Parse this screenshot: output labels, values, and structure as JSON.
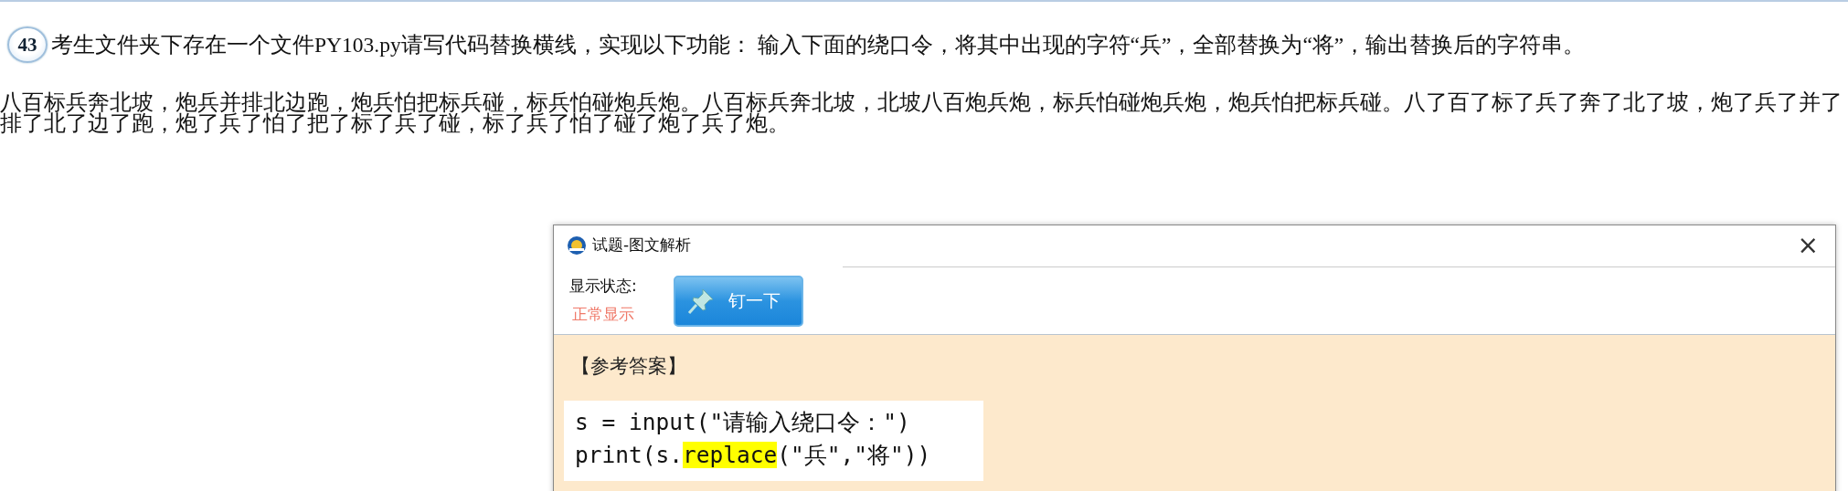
{
  "question": {
    "number": "43",
    "text": "考生文件夹下存在一个文件PY103.py请写代码替换横线，实现以下功能： 输入下面的绕口令，将其中出现的字符“兵”，全部替换为“将”，输出替换后的字符串。"
  },
  "tongue_twister": {
    "lines": [
      "八百标兵奔北坡，炮兵并排北边跑，炮兵怕把标兵碰，标兵怕碰炮兵炮。八百标兵奔北坡，北坡八百炮兵炮，标兵怕碰炮兵炮，炮兵怕把标兵碰。八了百了标了兵了奔了北了坡，炮了兵了并了",
      "排了北了边了跑，炮了兵了怕了把了标了兵了碰，标了兵了怕了碰了炮了兵了炮。"
    ]
  },
  "dialog": {
    "title": "试题-图文解析",
    "close": "×",
    "status_label": "显示状态:",
    "status_value": "正常显示",
    "pin_button": "钉一下",
    "answer_heading": "【参考答案】",
    "code_lines": [
      {
        "segments": [
          {
            "text": "s = input(\"请输入绕口令：\")",
            "highlighted": false
          }
        ]
      },
      {
        "segments": [
          {
            "text": "print(s.",
            "highlighted": false
          },
          {
            "text": "replace",
            "highlighted": true
          },
          {
            "text": "(\"兵\",\"将\"))",
            "highlighted": false
          }
        ]
      }
    ]
  }
}
